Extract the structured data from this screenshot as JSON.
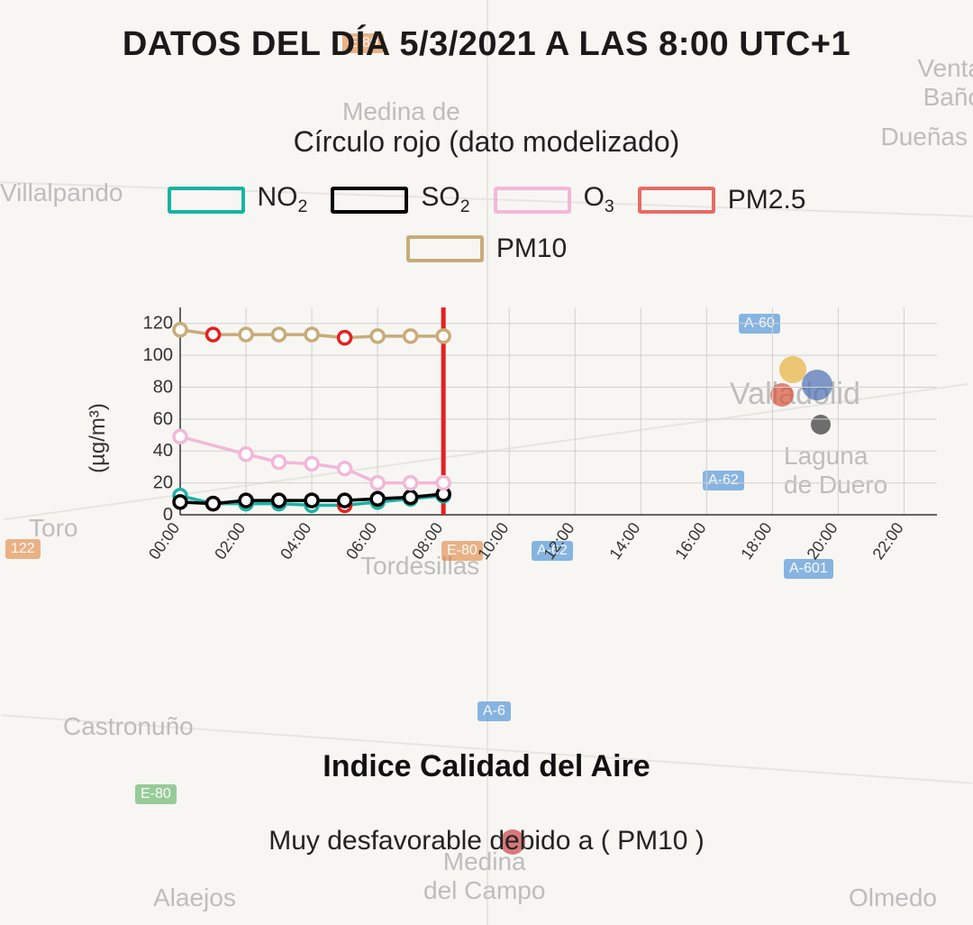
{
  "title": "DATOS DEL DÍA 5/3/2021 A LAS 8:00 UTC+1",
  "subtitle": "Círculo rojo (dato modelizado)",
  "legend": {
    "no2": "NO",
    "no2_sub": "2",
    "so2": "SO",
    "so2_sub": "2",
    "o3": "O",
    "o3_sub": "3",
    "pm25": "PM2.5",
    "pm10": "PM10"
  },
  "ylabel": "(µg/m³)",
  "footer": {
    "heading": "Indice Calidad del Aire",
    "status": "Muy desfavorable debido a ( PM10 )"
  },
  "map_labels": {
    "villalpando": "Villalpando",
    "medina_rioseco": "Medina de",
    "duenas": "Dueñas",
    "venta_banos": "Venta\nBaño",
    "valladolid": "Valladolid",
    "laguna": "Laguna\nde Duero",
    "toro": "Toro",
    "tordesillas": "Tordesillas",
    "castronuno": "Castronuño",
    "alaejos": "Alaejos",
    "medina_campo": "Medina\ndel Campo",
    "olmedo": "Olmedo"
  },
  "road_tags": {
    "a60": "A-60",
    "a6": "A-6",
    "a62": "A-62",
    "e80": "E-80",
    "a601": "A-601",
    "n122": "122"
  },
  "colors": {
    "no2": "#18b3a4",
    "so2": "#000000",
    "o3": "#f2b8d8",
    "pm25": "#e86a66",
    "pm10": "#c9ab7a",
    "modeled": "#e42020",
    "grid": "#d0d0d0",
    "axis": "#333333"
  },
  "chart_data": {
    "type": "line",
    "xlabel": "",
    "ylabel": "(µg/m³)",
    "ylim": [
      0,
      130
    ],
    "y_ticks": [
      0,
      20,
      40,
      60,
      80,
      100,
      120
    ],
    "categories": [
      "00:00",
      "01:00",
      "02:00",
      "03:00",
      "04:00",
      "05:00",
      "06:00",
      "07:00",
      "08:00",
      "09:00",
      "10:00",
      "11:00",
      "12:00",
      "13:00",
      "14:00",
      "15:00",
      "16:00",
      "17:00",
      "18:00",
      "19:00",
      "20:00",
      "21:00",
      "22:00",
      "23:00"
    ],
    "x_tick_every": 2,
    "current_index": 8,
    "series": [
      {
        "name": "NO2",
        "color": "#18b3a4",
        "modeled": [
          false,
          true,
          false,
          false,
          false,
          true,
          false,
          false,
          false
        ],
        "values": [
          12,
          7,
          7,
          7,
          6,
          6,
          8,
          10,
          12
        ]
      },
      {
        "name": "SO2",
        "color": "#000000",
        "modeled": [
          false,
          false,
          false,
          false,
          false,
          false,
          false,
          false,
          false
        ],
        "values": [
          8,
          7,
          9,
          9,
          9,
          9,
          10,
          11,
          13
        ]
      },
      {
        "name": "O3",
        "color": "#f2b8d8",
        "modeled": [
          false,
          false,
          false,
          false,
          false,
          false,
          false,
          false,
          false
        ],
        "values": [
          49,
          null,
          38,
          33,
          32,
          29,
          20,
          20,
          20
        ]
      },
      {
        "name": "PM2.5",
        "color": "#e86a66",
        "modeled": [
          false,
          false,
          false,
          false,
          false,
          false,
          false,
          false,
          false
        ],
        "values": [
          null,
          null,
          null,
          null,
          null,
          null,
          null,
          null,
          null
        ]
      },
      {
        "name": "PM10",
        "color": "#c9ab7a",
        "modeled": [
          false,
          true,
          false,
          false,
          false,
          true,
          false,
          false,
          false
        ],
        "values": [
          116,
          113,
          113,
          113,
          113,
          111,
          112,
          112,
          112
        ]
      }
    ],
    "title": "",
    "annotations": [
      "Círculo rojo (dato modelizado)"
    ]
  }
}
